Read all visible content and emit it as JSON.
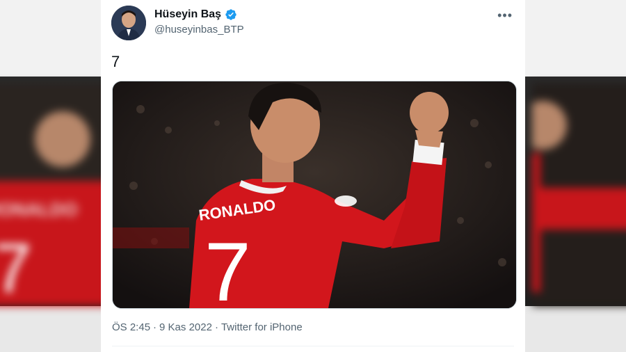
{
  "tweet": {
    "author": {
      "display_name": "Hüseyin Baş",
      "handle": "@huseyinbas_BTP",
      "verified": true
    },
    "text": "7",
    "media": {
      "jersey_name": "RONALDO",
      "jersey_number": "7",
      "colors": {
        "shirt": "#d2161c",
        "crowd": "#2b2420",
        "skin": "#c98d6a"
      }
    },
    "meta": {
      "time": "ÖS 2:45",
      "separator": "·",
      "date": "9 Kas 2022",
      "source": "Twitter for iPhone"
    },
    "icons": {
      "verified": "verified-badge-icon",
      "more": "more-options-icon"
    }
  },
  "background_side_text": {
    "left_jersey_name": "RONALDO",
    "left_jersey_number": "7"
  }
}
